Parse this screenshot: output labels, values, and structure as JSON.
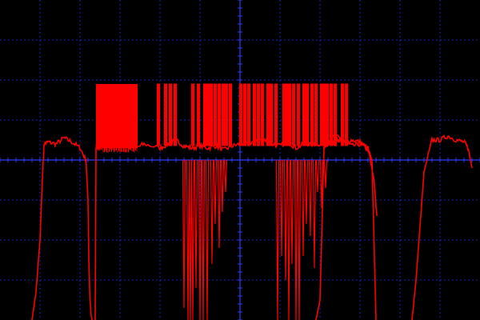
{
  "chart_data": {
    "type": "line",
    "title": "",
    "xlabel": "",
    "ylabel": "",
    "grid": true,
    "xlim": [
      -6,
      6
    ],
    "ylim": [
      -4,
      4
    ],
    "x_divisions": 12,
    "y_divisions": 8,
    "x_subdivisions": 5,
    "y_subdivisions": 5,
    "colors": {
      "background": "#000000",
      "grid": "#1a2cff",
      "axis": "#2a3cff",
      "trace": "#ff0000"
    },
    "series": [
      {
        "kind": "envelope",
        "x": [
          -5.2,
          -5.1,
          -5.0,
          -4.95,
          -4.9,
          -4.8,
          -4.6,
          -4.4,
          -4.2,
          -4.0,
          -3.85,
          -3.8,
          -3.78,
          -3.75,
          -3.72,
          -3.7
        ],
        "y": [
          -4.0,
          -3.3,
          -2.0,
          -0.7,
          0.4,
          0.45,
          0.4,
          0.55,
          0.45,
          0.3,
          0.0,
          -1.0,
          -2.5,
          -3.5,
          -3.9,
          -4.0
        ]
      },
      {
        "kind": "envelope",
        "x": [
          -3.62,
          -3.6,
          -3.0,
          -2.6,
          -2.4,
          -2.0,
          -1.8,
          -1.6,
          -1.4,
          -1.2,
          -1.0,
          -0.8,
          -0.6,
          -0.4,
          -0.2,
          0.0,
          0.2,
          0.4,
          0.6,
          0.8,
          1.0,
          1.2,
          1.4,
          1.6,
          1.8,
          2.0,
          2.2,
          2.4,
          2.6,
          2.8,
          3.0,
          3.2,
          3.3,
          3.4
        ],
        "y": [
          -4.0,
          0.3,
          0.35,
          0.3,
          0.4,
          0.3,
          0.4,
          0.5,
          0.35,
          0.3,
          0.35,
          0.3,
          0.35,
          0.25,
          0.35,
          0.4,
          0.4,
          0.5,
          0.5,
          0.4,
          0.35,
          0.45,
          0.3,
          0.4,
          0.4,
          0.4,
          0.5,
          0.6,
          0.45,
          0.35,
          0.4,
          0.25,
          0.0,
          -4.0
        ]
      },
      {
        "kind": "envelope",
        "x": [
          1.9,
          2.0,
          2.1,
          2.2,
          2.3,
          2.4,
          2.5,
          2.6,
          2.8,
          3.0,
          3.2,
          3.35,
          3.42
        ],
        "y": [
          -4.0,
          -3.5,
          0.3,
          0.4,
          0.45,
          0.5,
          0.5,
          0.45,
          0.5,
          0.45,
          0.3,
          -0.5,
          -1.4
        ]
      },
      {
        "kind": "envelope",
        "x": [
          4.3,
          4.4,
          4.6,
          4.8,
          5.0,
          5.2,
          5.4,
          5.6,
          5.7,
          5.8
        ],
        "y": [
          -4.0,
          -3.0,
          -0.3,
          0.5,
          0.5,
          0.6,
          0.5,
          0.45,
          0.3,
          -0.2
        ]
      },
      {
        "kind": "noise_band",
        "x_range": [
          -3.6,
          -2.56
        ],
        "y_range": [
          0.3,
          1.9
        ]
      },
      {
        "kind": "spikes_up",
        "x": [
          -2.04,
          -1.86,
          -1.74,
          -1.62,
          -1.18,
          -1.04,
          -0.88,
          -0.8,
          -0.72,
          -0.62,
          -0.52,
          -0.42,
          -0.34,
          -0.24,
          0.02,
          0.12,
          0.22,
          0.36,
          0.46,
          0.56,
          0.7,
          0.78,
          0.9,
          1.1,
          1.16,
          1.24,
          1.34,
          1.46,
          1.6,
          1.68,
          1.8,
          1.9,
          2.04,
          2.12,
          2.18,
          2.28,
          2.38,
          2.56,
          2.66
        ],
        "top": 1.9
      },
      {
        "kind": "spikes_down",
        "x": [
          -1.4,
          -1.3,
          -1.24,
          -1.18,
          -1.1,
          -1.0,
          -0.92,
          -0.82,
          -0.7,
          -0.62,
          -0.52,
          -0.44,
          -0.36,
          0.94,
          1.04,
          1.14,
          1.22,
          1.3,
          1.4,
          1.48,
          1.58,
          1.66,
          1.76,
          1.86,
          1.94,
          2.04,
          2.14
        ],
        "bottom": [
          -3.7,
          -4.0,
          -4.0,
          -4.0,
          -3.2,
          -4.0,
          -4.0,
          -4.0,
          -2.6,
          -1.6,
          -2.2,
          -1.3,
          -0.8,
          -4.0,
          -2.4,
          -3.0,
          -4.0,
          -2.6,
          -4.0,
          -4.0,
          -2.4,
          -1.6,
          -1.9,
          -2.7,
          -0.8,
          -1.2,
          -0.7
        ]
      }
    ]
  }
}
